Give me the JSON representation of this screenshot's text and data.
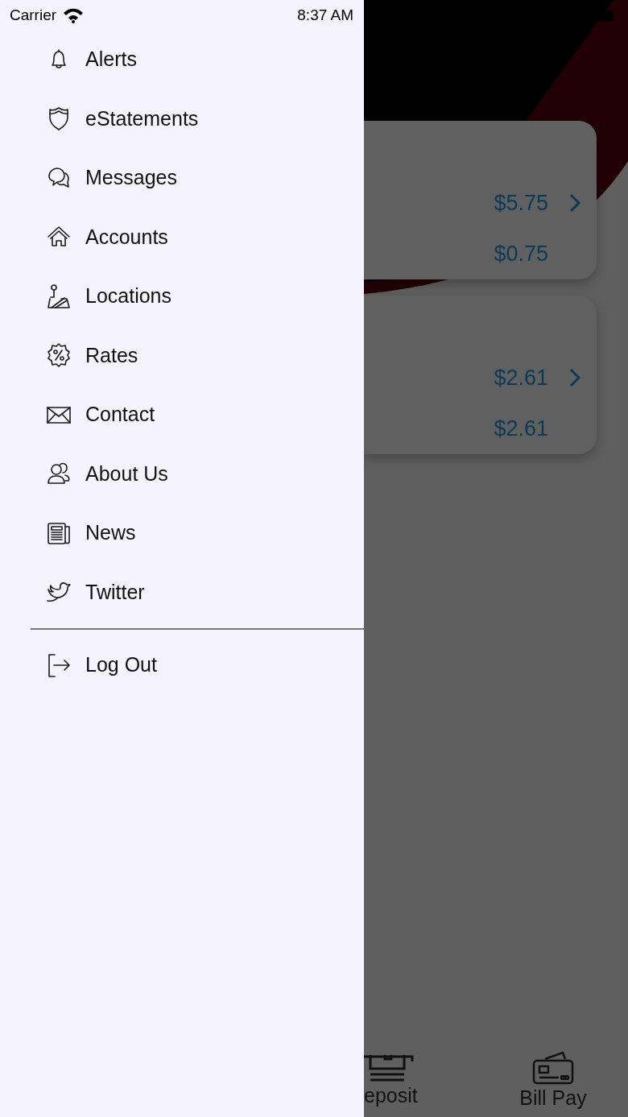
{
  "status_bar": {
    "carrier": "Carrier",
    "time": "8:37 AM"
  },
  "drawer": {
    "items": [
      {
        "label": "Alerts"
      },
      {
        "label": "eStatements"
      },
      {
        "label": "Messages"
      },
      {
        "label": "Accounts"
      },
      {
        "label": "Locations"
      },
      {
        "label": "Rates"
      },
      {
        "label": "Contact"
      },
      {
        "label": "About Us"
      },
      {
        "label": "News"
      },
      {
        "label": "Twitter"
      }
    ],
    "log_out": {
      "label": "Log Out"
    }
  },
  "accounts": [
    {
      "amounts": [
        "$5.75",
        "$0.75"
      ]
    },
    {
      "amounts": [
        "$2.61",
        "$2.61"
      ]
    }
  ],
  "tab_bar": [
    {
      "label": "eposit"
    },
    {
      "label": "Bill Pay"
    }
  ]
}
